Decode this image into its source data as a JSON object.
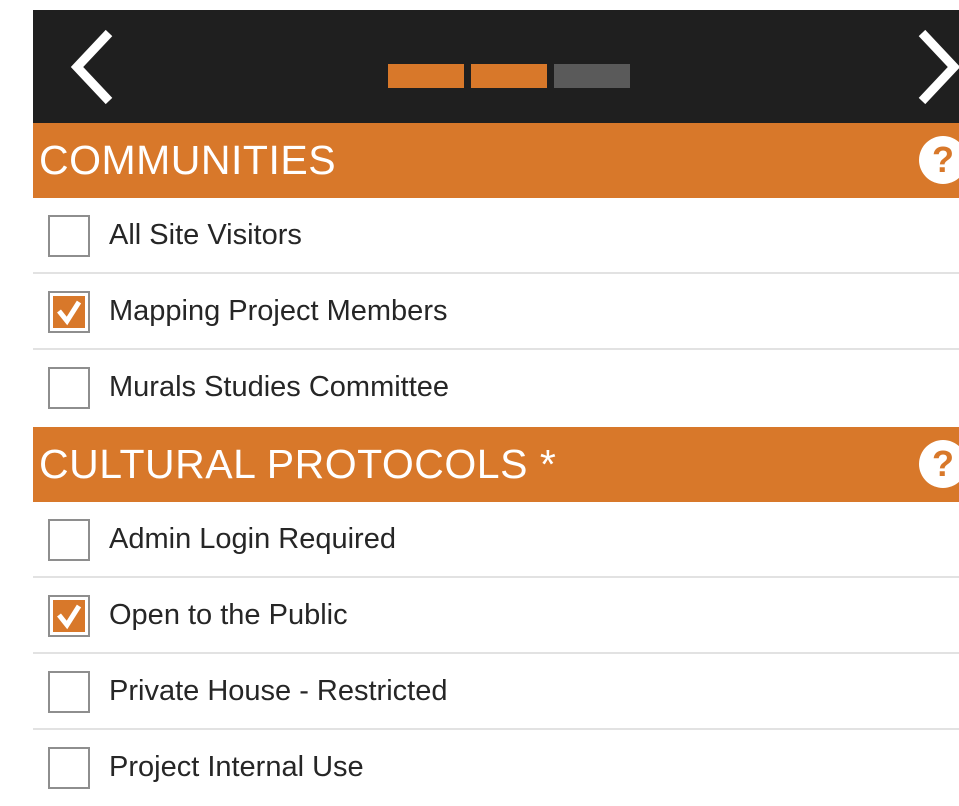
{
  "colors": {
    "accent": "#d8782a",
    "topbar": "#1f1f1f",
    "step_inactive": "#5a5a5a",
    "text": "#262626",
    "divider": "#e2e2e2"
  },
  "topbar": {
    "prev_icon": "chevron-left-icon",
    "next_icon": "chevron-right-icon",
    "steps_total": 3,
    "steps_completed": 2
  },
  "communities": {
    "title": "COMMUNITIES",
    "help_icon": "?",
    "items": [
      {
        "label": "All Site Visitors",
        "checked": false
      },
      {
        "label": "Mapping Project Members",
        "checked": true
      },
      {
        "label": "Murals Studies Committee",
        "checked": false
      }
    ]
  },
  "protocols": {
    "title": "CULTURAL PROTOCOLS *",
    "help_icon": "?",
    "items": [
      {
        "label": "Admin Login Required",
        "checked": false
      },
      {
        "label": "Open to the Public",
        "checked": true
      },
      {
        "label": "Private House - Restricted",
        "checked": false
      },
      {
        "label": "Project Internal Use",
        "checked": false
      }
    ]
  }
}
